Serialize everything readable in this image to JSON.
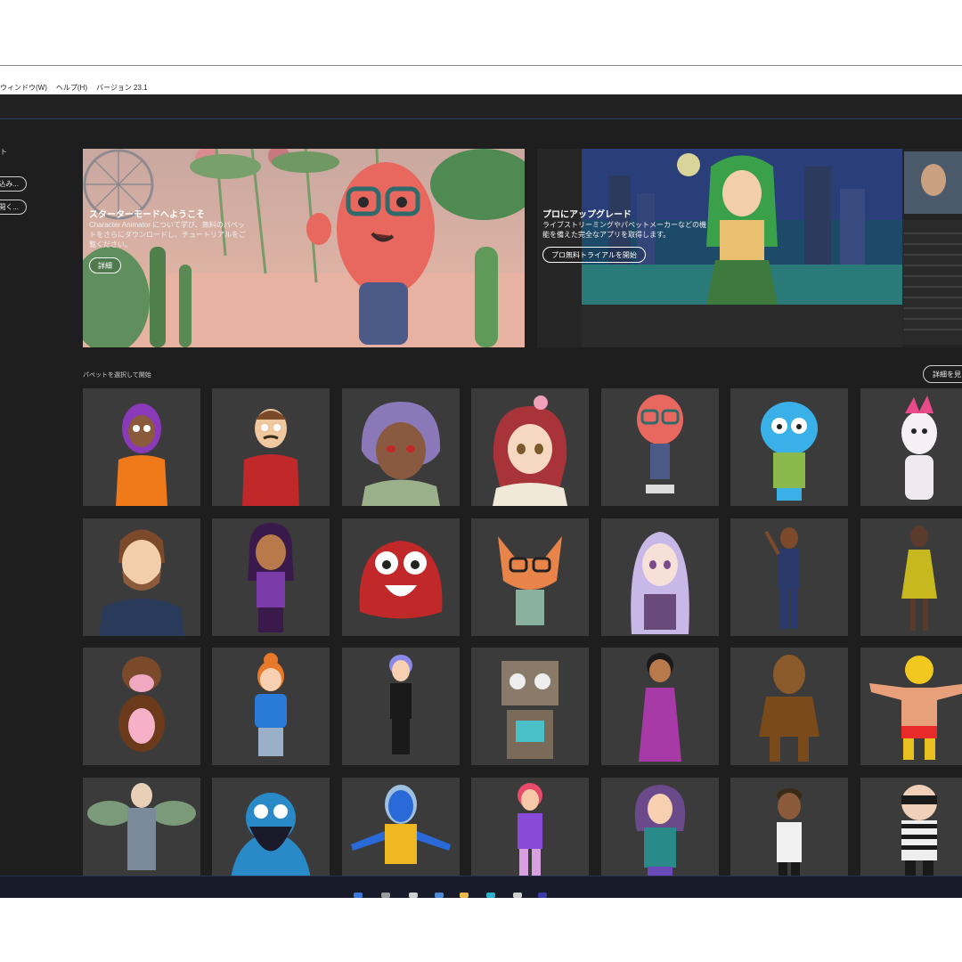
{
  "menubar": {
    "items": [
      "ウィンドウ(W)",
      "ヘルプ(H)",
      "バージョン 23.1"
    ]
  },
  "sidebar": {
    "title": "ト",
    "buttons": [
      "込み...",
      "開く..."
    ]
  },
  "hero_starter": {
    "title": "スターターモードへようこそ",
    "description": "Character Animator について学び、無料のパペットをさらにダウンロードし、チュートリアルをご覧ください。",
    "button": "詳細"
  },
  "hero_pro": {
    "title": "プロにアップグレード",
    "description": "ライブストリーミングやパペットメーカーなどの機能を備えた完全なアプリを取得します。",
    "button": "プロ無料トライアルを開始"
  },
  "puppets": {
    "section_label": "パペットを選択して開始",
    "more_button": "詳細を見"
  },
  "colors": {
    "app_bg": "#1e1e1e",
    "tile_bg": "#3b3b3b",
    "accent": "#2f3d64"
  }
}
